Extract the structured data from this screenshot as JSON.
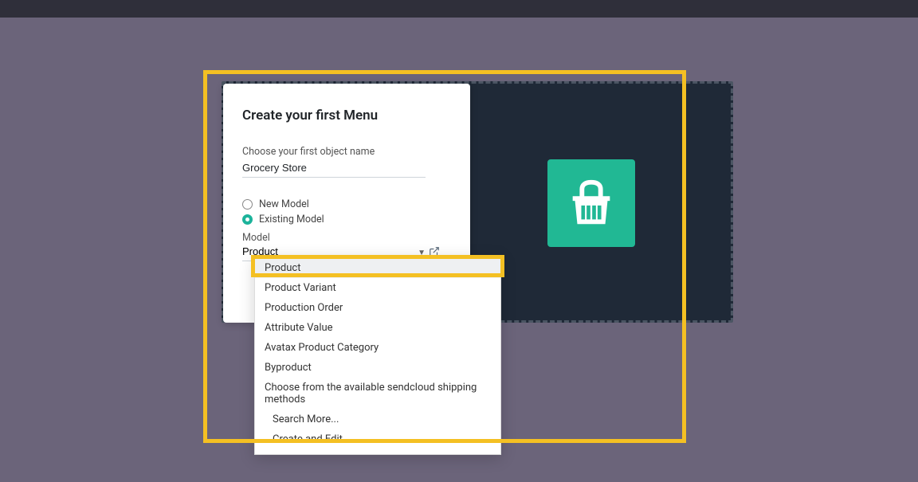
{
  "form": {
    "title": "Create your first Menu",
    "object_name_label": "Choose your first object name",
    "object_name_value": "Grocery Store",
    "radio_new_model": "New Model",
    "radio_existing_model": "Existing Model",
    "model_label": "Model",
    "model_value": "Product"
  },
  "dropdown": {
    "items": [
      "Product",
      "Product Variant",
      "Production Order",
      "Attribute Value",
      "Avatax Product Category",
      "Byproduct",
      "Choose from the available sendcloud shipping methods"
    ],
    "search_more": "Search More...",
    "create_edit": "Create and Edit..."
  },
  "icon": {
    "name": "shopping-basket-icon"
  }
}
